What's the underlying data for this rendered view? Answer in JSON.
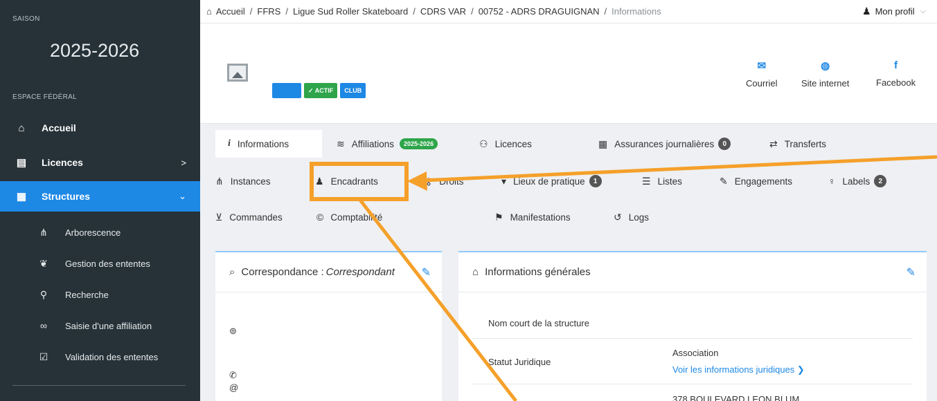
{
  "sidebar": {
    "season_label": "SAISON",
    "season_value": "2025-2026",
    "space_label": "ESPACE FÉDÉRAL",
    "items": [
      {
        "label": "Accueil",
        "icon": "home-icon"
      },
      {
        "label": "Licences",
        "icon": "card-icon",
        "chevron": ">"
      },
      {
        "label": "Structures",
        "icon": "building-icon",
        "chevron": "⌄"
      }
    ],
    "sub_items": [
      {
        "label": "Arborescence",
        "icon": "sitemap-icon"
      },
      {
        "label": "Gestion des ententes",
        "icon": "handshake-icon"
      },
      {
        "label": "Recherche",
        "icon": "search-icon"
      },
      {
        "label": "Saisie d'une affiliation",
        "icon": "link-icon"
      },
      {
        "label": "Validation des ententes",
        "icon": "check-card-icon"
      }
    ]
  },
  "breadcrumb": {
    "items": [
      "Accueil",
      "FFRS",
      "Ligue Sud Roller Skateboard",
      "CDRS VAR",
      "00752 - ADRS DRAGUIGNAN",
      "Informations"
    ],
    "separator": "/"
  },
  "profile": {
    "label": "Mon profil"
  },
  "header": {
    "badges": {
      "blank": "",
      "status": "✓ ACTIF",
      "type": "CLUB"
    },
    "social": [
      {
        "label": "Courriel",
        "icon": "mail-icon"
      },
      {
        "label": "Site internet",
        "icon": "globe-icon"
      },
      {
        "label": "Facebook",
        "icon": "facebook-icon"
      }
    ]
  },
  "tabs": {
    "row1": [
      {
        "label": "Informations",
        "icon": "info-icon"
      },
      {
        "label": "Affiliations",
        "icon": "layers-icon",
        "pill": "2025-2026"
      },
      {
        "label": "Licences",
        "icon": "users-icon"
      },
      {
        "label": "Assurances journalières",
        "icon": "calendar-icon",
        "count": "0"
      },
      {
        "label": "Transferts",
        "icon": "transfer-icon"
      }
    ],
    "row2": [
      {
        "label": "Instances",
        "icon": "sitemap-icon"
      },
      {
        "label": "Encadrants",
        "icon": "coach-icon"
      },
      {
        "label": "Droits",
        "icon": "key-icon"
      },
      {
        "label": "Lieux de pratique",
        "icon": "map-pin-icon",
        "count": "1"
      },
      {
        "label": "Listes",
        "icon": "list-icon"
      },
      {
        "label": "Engagements",
        "icon": "edit-icon"
      },
      {
        "label": "Labels",
        "icon": "bulb-icon",
        "count": "2"
      }
    ],
    "row3": [
      {
        "label": "Commandes",
        "icon": "cart-icon"
      },
      {
        "label": "Comptabilité",
        "icon": "copyright-icon"
      },
      {
        "label": "Manifestations",
        "icon": "flag-icon"
      },
      {
        "label": "Logs",
        "icon": "history-icon"
      }
    ]
  },
  "correspondance": {
    "title": "Correspondance : ",
    "title_italic": "Correspondant"
  },
  "infos": {
    "title": "Informations générales",
    "rows": [
      {
        "label": "Nom court de la structure",
        "value": ""
      },
      {
        "label": "Statut Juridique",
        "value": "Association",
        "link": "Voir les informations juridiques ❯"
      },
      {
        "label": "",
        "value": "378 BOULEVARD LEON BLUM"
      }
    ]
  },
  "colors": {
    "accent": "#1e88e5",
    "sidebar": "#263238",
    "annotation": "#f5a02a",
    "success": "#2ea54a"
  }
}
